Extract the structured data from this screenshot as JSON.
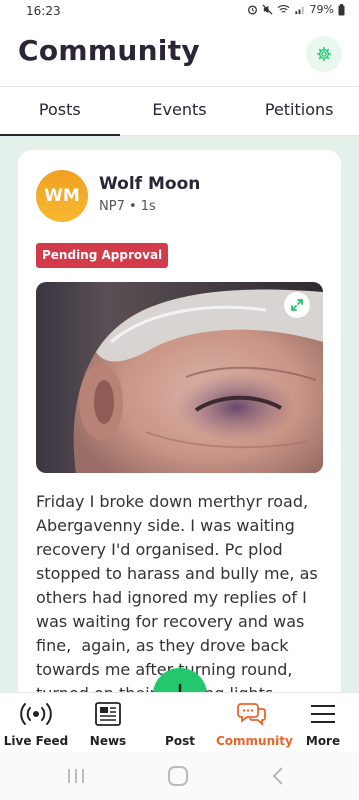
{
  "status_bar": {
    "time": "16:23",
    "battery": "79%"
  },
  "header": {
    "title": "Community"
  },
  "tabs": [
    {
      "label": "Posts",
      "active": true
    },
    {
      "label": "Events",
      "active": false
    },
    {
      "label": "Petitions",
      "active": false
    }
  ],
  "post": {
    "avatar_initials": "WM",
    "author": "Wolf Moon",
    "meta": "NP7 • 1s",
    "badge": "Pending Approval",
    "text": "Friday I broke down merthyr road, Abergavenny side. I was waiting recovery I'd organised. Pc plod stopped to harass and bully me, as others had ignored my replies of I was waiting for recovery and was fine,  again, as they drove back towards me after turning round, turned on their flashing lights"
  },
  "bottom_nav": {
    "items": [
      {
        "label": "Live Feed",
        "icon": "broadcast-icon"
      },
      {
        "label": "News",
        "icon": "newspaper-icon"
      },
      {
        "label": "Post",
        "icon": "plus-icon"
      },
      {
        "label": "Community",
        "icon": "chat-bubbles-icon",
        "active": true
      },
      {
        "label": "More",
        "icon": "menu-icon"
      }
    ]
  },
  "colors": {
    "accent": "#22c76e",
    "active_nav": "#e8652b",
    "badge": "#d33a4a",
    "title": "#2b2536"
  }
}
